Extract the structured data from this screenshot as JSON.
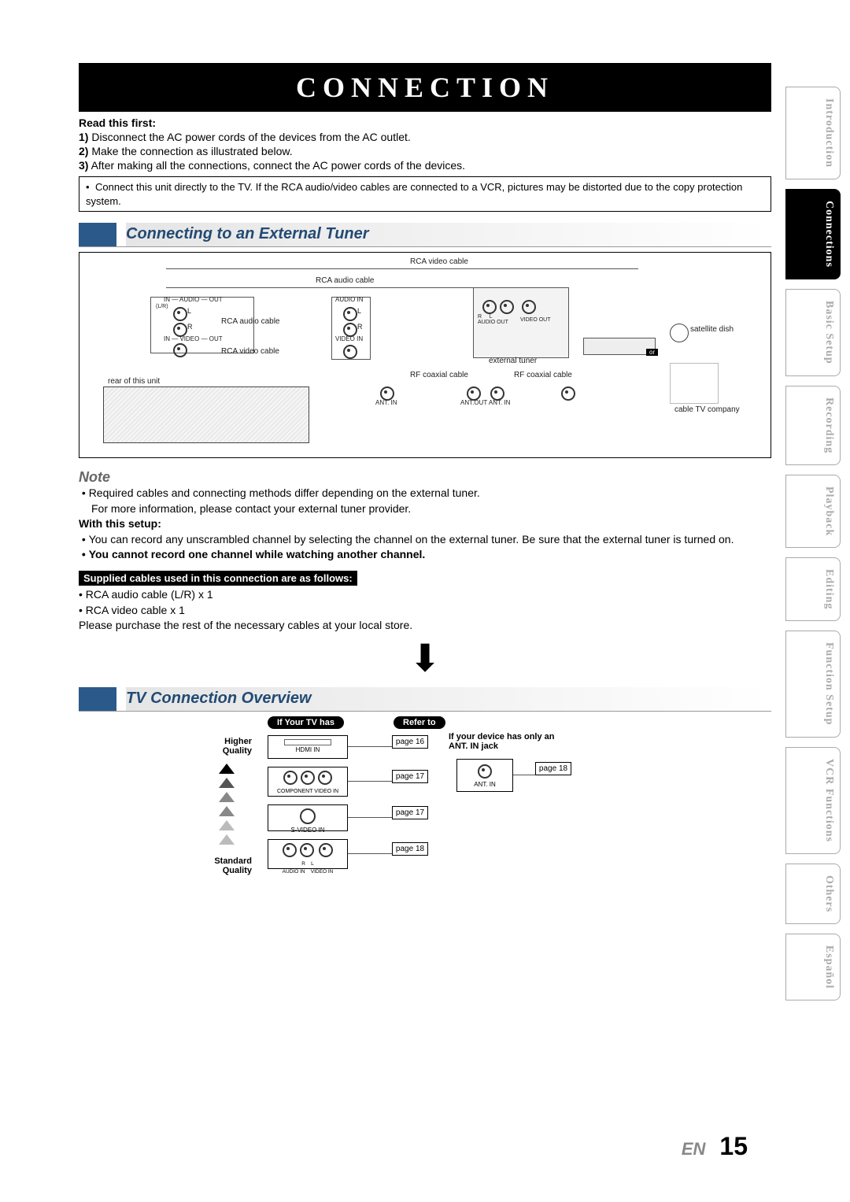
{
  "title": "Connection",
  "read_first_label": "Read this first:",
  "steps": [
    {
      "n": "1)",
      "t": "Disconnect the AC power cords of the devices from the AC outlet."
    },
    {
      "n": "2)",
      "t": "Make the connection as illustrated below."
    },
    {
      "n": "3)",
      "t": "After making all the connections, connect the AC power cords of the devices."
    }
  ],
  "top_note": "Connect this unit directly to the TV. If the RCA audio/video cables are connected to a VCR, pictures may be distorted due to the copy protection system.",
  "section1": "Connecting to an External Tuner",
  "diagram": {
    "rca_video_top": "RCA video cable",
    "rca_audio_top": "RCA audio  cable",
    "in_audio_out": "IN — AUDIO — OUT",
    "lr_label": "(L/R)",
    "l": "L",
    "r": "R",
    "in_video_out": "IN — VIDEO — OUT",
    "rca_audio_mid": "RCA audio cable",
    "rca_video_mid": "RCA video cable",
    "audio_in": "AUDIO IN",
    "video_in": "VIDEO IN",
    "rear": "rear of this unit",
    "ant_in": "ANT. IN",
    "rf_coax_left": "RF coaxial cable",
    "rf_coax_right": "RF coaxial cable",
    "ant_out_in": "ANT.OUT   ANT. IN",
    "audio_out_rl": "R     L\nAUDIO OUT",
    "video_out": "VIDEO OUT",
    "ext_tuner": "external tuner",
    "sat_dish": "satellite dish",
    "or": "or",
    "cabletv": "cable TV company"
  },
  "note_label": "Note",
  "note_lines": [
    "Required cables and connecting methods differ depending on the external tuner.",
    "For more information, please contact your external tuner provider."
  ],
  "with_setup_label": "With this setup:",
  "with_setup_lines": [
    "You can record any unscrambled channel by selecting the channel on the external tuner. Be sure that the external tuner is turned on."
  ],
  "cannot": "You cannot record one channel while watching another channel.",
  "supplied_header": "Supplied cables used in this connection are as follows:",
  "supplied_lines": [
    "RCA audio cable (L/R) x 1",
    "RCA video cable x 1"
  ],
  "purchase": "Please purchase the rest of the necessary cables at your local store.",
  "section2": "TV Connection Overview",
  "overview": {
    "header_if_tv_has": "If Your TV has",
    "header_refer_to": "Refer to",
    "higher": "Higher Quality",
    "standard": "Standard Quality",
    "rows": [
      {
        "label": "HDMI IN",
        "page": "page 16"
      },
      {
        "label": "COMPONENT VIDEO IN",
        "page": "page 17"
      },
      {
        "label": "S-VIDEO IN",
        "page": "page 17"
      },
      {
        "label": "R    L\nAUDIO IN    VIDEO IN",
        "page": "page 18"
      }
    ],
    "device_has": "If your device has only an ANT. IN jack",
    "ant_page": "page 18",
    "ant_in_small": "ANT. IN"
  },
  "footer": {
    "lang": "EN",
    "page": "15"
  },
  "tabs": [
    "Introduction",
    "Connections",
    "Basic Setup",
    "Recording",
    "Playback",
    "Editing",
    "Function Setup",
    "VCR Functions",
    "Others",
    "Español"
  ],
  "active_tab_index": 1
}
